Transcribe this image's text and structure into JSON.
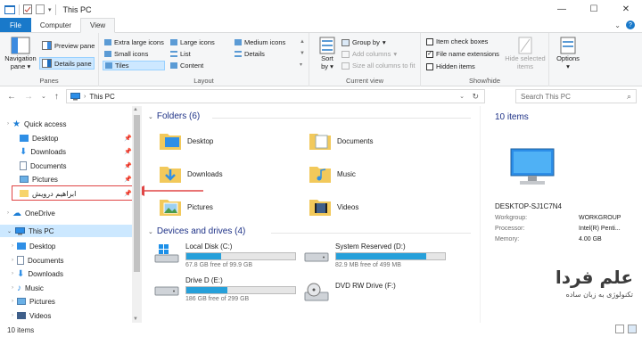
{
  "window": {
    "title": "This PC",
    "controls": [
      "minimize-icon",
      "maximize-icon",
      "close-icon"
    ]
  },
  "tabs": {
    "file": "File",
    "computer": "Computer",
    "view": "View"
  },
  "ribbon": {
    "panes": {
      "label": "Panes",
      "navigation_pane": "Navigation",
      "navigation_pane_2": "pane",
      "preview_pane": "Preview pane",
      "details_pane": "Details pane"
    },
    "layout": {
      "label": "Layout",
      "extra_large": "Extra large icons",
      "large": "Large icons",
      "medium": "Medium icons",
      "small": "Small icons",
      "list": "List",
      "details": "Details",
      "tiles": "Tiles",
      "content": "Content"
    },
    "current_view": {
      "label": "Current view",
      "sort_by": "Sort",
      "sort_by_2": "by",
      "group_by": "Group by",
      "add_columns": "Add columns",
      "size_all_columns": "Size all columns to fit"
    },
    "show_hide": {
      "label": "Show/hide",
      "item_check_boxes": "Item check boxes",
      "file_name_extensions": "File name extensions",
      "hidden_items": "Hidden items",
      "hide_selected": "Hide selected",
      "hide_selected_2": "items",
      "extensions_checked": true
    },
    "options": {
      "label": "Options"
    }
  },
  "addressbar": {
    "path": "This PC",
    "search_placeholder": "Search This PC"
  },
  "nav": {
    "quick_access": "Quick access",
    "items_quick": [
      "Desktop",
      "Downloads",
      "Documents",
      "Pictures",
      "ابراهیم درویش"
    ],
    "onedrive": "OneDrive",
    "this_pc": "This PC",
    "items_pc": [
      "Desktop",
      "Documents",
      "Downloads",
      "Music",
      "Pictures",
      "Videos"
    ]
  },
  "main": {
    "folders_header": "Folders (6)",
    "folders": [
      "Desktop",
      "Documents",
      "Downloads",
      "Music",
      "Pictures",
      "Videos"
    ],
    "drives_header": "Devices and drives (4)",
    "drives": [
      {
        "name": "Local Disk (C:)",
        "free": "67.8 GB free of 99.9 GB",
        "used_fraction": 0.32
      },
      {
        "name": "System Reserved (D:)",
        "free": "82.9 MB free of 499 MB",
        "used_fraction": 0.83
      },
      {
        "name": "Drive D (E:)",
        "free": "186 GB free of 299 GB",
        "used_fraction": 0.38
      },
      {
        "name": "DVD RW Drive (F:)",
        "free": ""
      }
    ]
  },
  "details": {
    "count": "10 items",
    "computer_name": "DESKTOP-SJ1C7N4",
    "rows": [
      {
        "k": "Workgroup:",
        "v": "WORKGROUP"
      },
      {
        "k": "Processor:",
        "v": "Intel(R) Penti..."
      },
      {
        "k": "Memory:",
        "v": "4.00 GB"
      }
    ]
  },
  "watermark": {
    "title": "علم فردا",
    "subtitle": "تکنولوژی به زبان ساده"
  },
  "status": {
    "count": "10 items"
  }
}
